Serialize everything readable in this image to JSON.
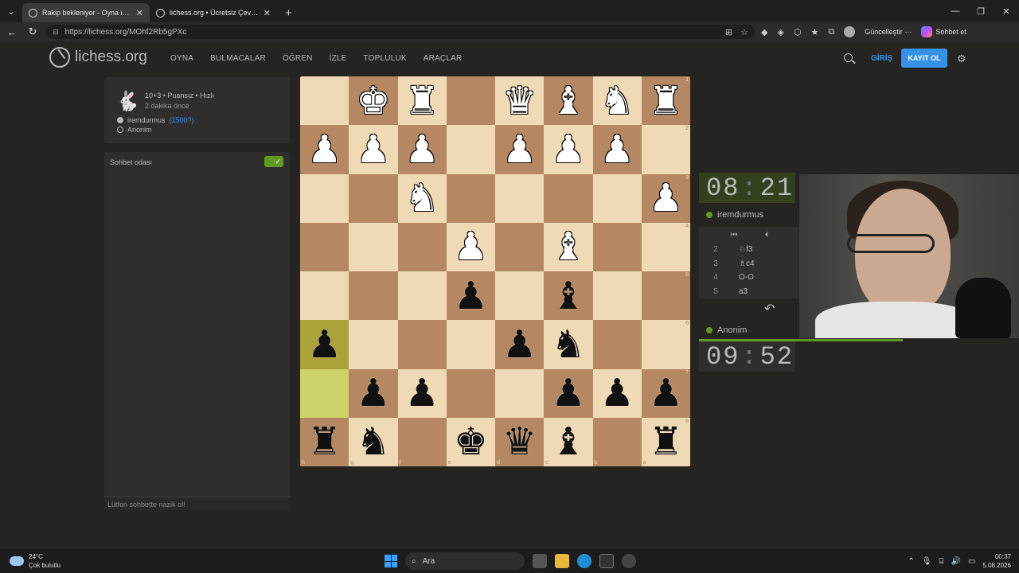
{
  "browser": {
    "tabs": [
      {
        "title": "Rakip bekleniyor - Oyna iremdurmus",
        "active": true
      },
      {
        "title": "lichess.org • Ücretsiz Çevrimiçi Satranç",
        "active": false
      }
    ],
    "url": "https://lichess.org/MOhf2Rb5gPXc",
    "update_label": "Güncelleştir",
    "chat_label": "Sohbet et"
  },
  "site": {
    "logo_text": "lichess.org",
    "nav": [
      "OYNA",
      "BULMACALAR",
      "ÖĞREN",
      "İZLE",
      "TOPLULUK",
      "ARAÇLAR"
    ],
    "login_label": "GİRİŞ",
    "signup_label": "KAYIT OL"
  },
  "game": {
    "mode": "10+3 • Puansız • Hızlı",
    "time_ago": "2 dakika önce",
    "white_player": "iremdurmus",
    "white_rating": "(1500?)",
    "black_player": "Anonim"
  },
  "chat": {
    "title": "Sohbet odası",
    "placeholder": "Lütfen sohbette nazik ol!"
  },
  "board": {
    "orientation": "black",
    "rank_labels": [
      "1",
      "2",
      "3",
      "4",
      "5",
      "6",
      "7",
      "8"
    ],
    "file_labels": [
      "h",
      "g",
      "f",
      "e",
      "d",
      "c",
      "b",
      "a"
    ],
    "rows": [
      [
        "",
        "wK",
        "wR",
        "",
        "wQ",
        "wB",
        "wN",
        "wR"
      ],
      [
        "wP",
        "wP",
        "wP",
        "",
        "wP",
        "wP",
        "wP",
        ""
      ],
      [
        "",
        "",
        "wN",
        "",
        "",
        "",
        "",
        "wP"
      ],
      [
        "",
        "",
        "",
        "wP",
        "",
        "wB",
        "",
        ""
      ],
      [
        "",
        "",
        "",
        "bP",
        "",
        "bB",
        "",
        ""
      ],
      [
        "bP",
        "",
        "",
        "",
        "bP",
        "bN",
        "",
        ""
      ],
      [
        "",
        "bP",
        "bP",
        "",
        "",
        "bP",
        "bP",
        "bP"
      ],
      [
        "bR",
        "bN",
        "",
        "bK",
        "bQ",
        "bB",
        "",
        "bR"
      ]
    ],
    "highlight": [
      [
        5,
        0
      ],
      [
        6,
        0
      ]
    ]
  },
  "clocks": {
    "top": {
      "min": "08",
      "sec": "21",
      "player": "iremdurmus"
    },
    "bottom": {
      "min": "09",
      "sec": "52",
      "player": "Anonim"
    }
  },
  "moves": [
    {
      "num": "2",
      "white": "♘f3"
    },
    {
      "num": "3",
      "white": "♗c4"
    },
    {
      "num": "4",
      "white": "O-O"
    },
    {
      "num": "5",
      "white": "a3"
    }
  ],
  "taskbar": {
    "temperature": "24°C",
    "weather": "Çok bulutlu",
    "search_label": "Ara",
    "time": "00:37",
    "date": "5.08.2026"
  }
}
